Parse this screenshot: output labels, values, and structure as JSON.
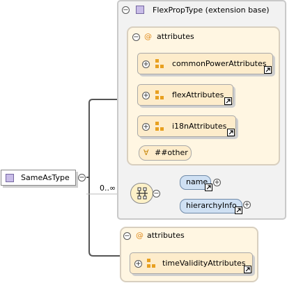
{
  "root": {
    "label": "SameAsType"
  },
  "extension": {
    "title": "FlexPropType (extension base)",
    "attributes_label": "attributes",
    "attribute_groups": [
      "commonPowerAttributes",
      "flexAttributes",
      "i18nAttributes"
    ],
    "any_attribute": "##other"
  },
  "sequence": {
    "cardinality": "0..∞",
    "elements": [
      "name",
      "hierarchyInfo"
    ]
  },
  "own_attributes": {
    "label": "attributes",
    "attribute_groups": [
      "timeValidityAttributes"
    ]
  },
  "symbols": {
    "at": "@",
    "minus": "−",
    "plus": "+",
    "any": "∀"
  },
  "colors": {
    "attribute_group_fill": "#fdeccb",
    "attribute_panel_fill": "#fff6e2",
    "element_fill": "#cfe0f3",
    "complex_type_icon": "#c9bde8",
    "group_icon": "#e8a020"
  }
}
